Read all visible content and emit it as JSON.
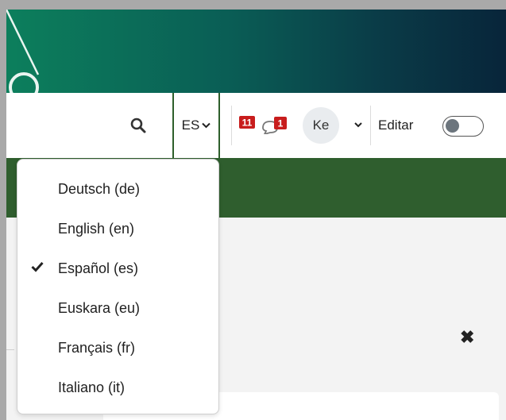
{
  "header": {
    "language_button": "ES",
    "notifications_count": "11",
    "messages_count": "1",
    "user_initials": "Ke",
    "edit_label": "Editar",
    "edit_mode_on": false
  },
  "language_menu": {
    "items": [
      {
        "label": "Deutsch (de)",
        "selected": false
      },
      {
        "label": "English (en)",
        "selected": false
      },
      {
        "label": "Español (es)",
        "selected": true
      },
      {
        "label": "Euskara (eu)",
        "selected": false
      },
      {
        "label": "Français (fr)",
        "selected": false
      },
      {
        "label": "Italiano (it)",
        "selected": false
      }
    ]
  },
  "icons": {
    "search": "search-icon",
    "caret": "chevron-down-icon",
    "notifications": "bell-icon",
    "messages": "chat-bubble-icon",
    "close": "close-icon",
    "check": "check-icon"
  },
  "colors": {
    "banner_start": "#0c7f5c",
    "banner_end": "#08253a",
    "accent_green": "#2f5e2e",
    "badge_red": "#c81d1d"
  }
}
